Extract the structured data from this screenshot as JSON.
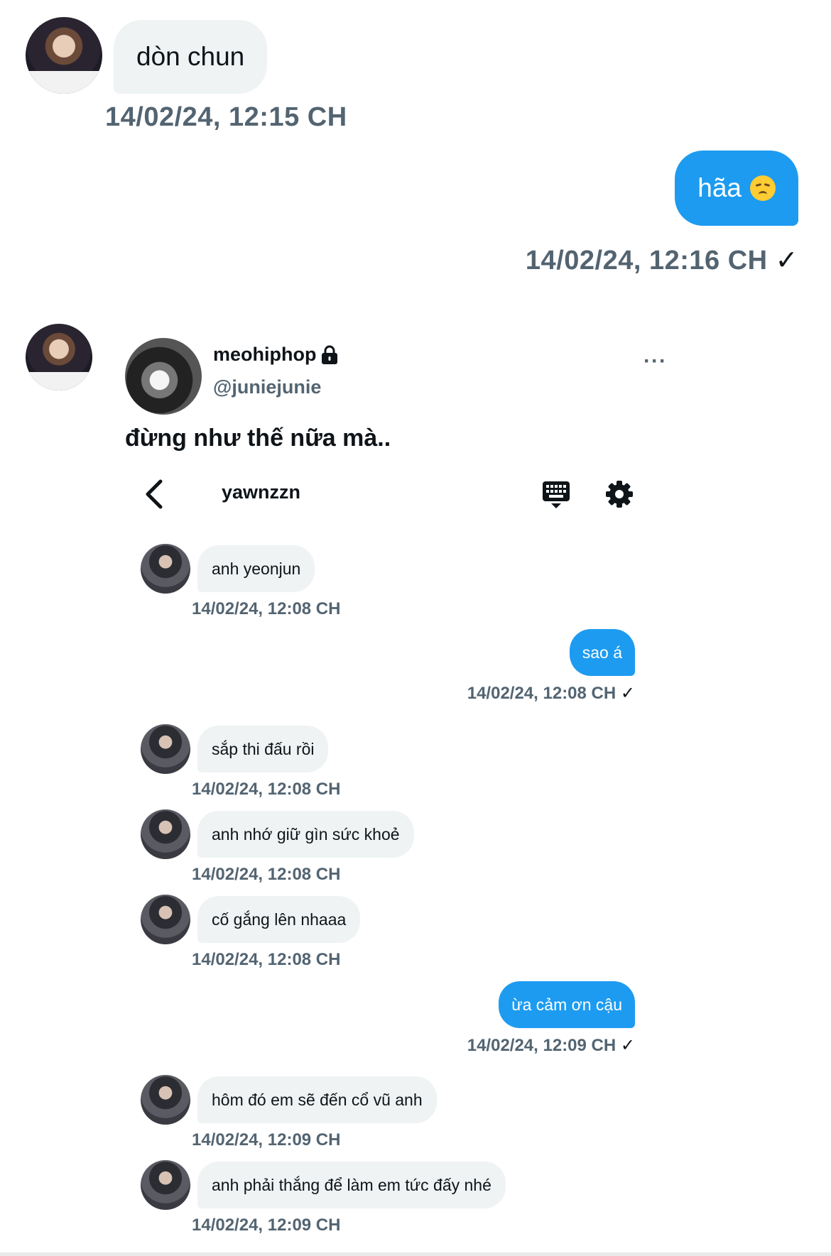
{
  "thread": {
    "msg1": {
      "text": "dòn chun",
      "time": "14/02/24, 12:15 CH"
    },
    "msg2": {
      "text": "hãa",
      "emoji": "disappointed-face-emoji",
      "time": "14/02/24, 12:16 CH",
      "check": "✓"
    }
  },
  "tweet": {
    "name": "meohiphop",
    "handle": "@juniejunie",
    "text": "đừng như thế nữa mà..",
    "more": "···"
  },
  "dm": {
    "title": "yawnzzn",
    "icons": {
      "back": "chevron-left-icon",
      "keyboard": "keyboard-icon",
      "settings": "gear-icon"
    },
    "messages": [
      {
        "dir": "in",
        "text": "anh yeonjun",
        "time": "14/02/24, 12:08 CH"
      },
      {
        "dir": "out",
        "text": "sao á",
        "time": "14/02/24, 12:08 CH",
        "check": "✓"
      },
      {
        "dir": "in",
        "text": "sắp thi đấu rồi",
        "time": "14/02/24, 12:08 CH"
      },
      {
        "dir": "in",
        "text": "anh nhớ giữ gìn sức khoẻ",
        "time": "14/02/24, 12:08 CH"
      },
      {
        "dir": "in",
        "text": "cố gắng lên nhaaa",
        "time": "14/02/24, 12:08 CH"
      },
      {
        "dir": "out",
        "text": "ừa cảm ơn cậu",
        "time": "14/02/24, 12:09 CH",
        "check": "✓"
      },
      {
        "dir": "in",
        "text": "hôm đó em sẽ đến cổ vũ anh",
        "time": "14/02/24, 12:09 CH"
      },
      {
        "dir": "in",
        "text": "anh phải thắng để làm em tức đấy nhé",
        "time": "14/02/24, 12:09 CH"
      }
    ]
  },
  "colors": {
    "accent": "#1d9bf0",
    "incoming": "#eff3f4",
    "muted": "#536471"
  }
}
